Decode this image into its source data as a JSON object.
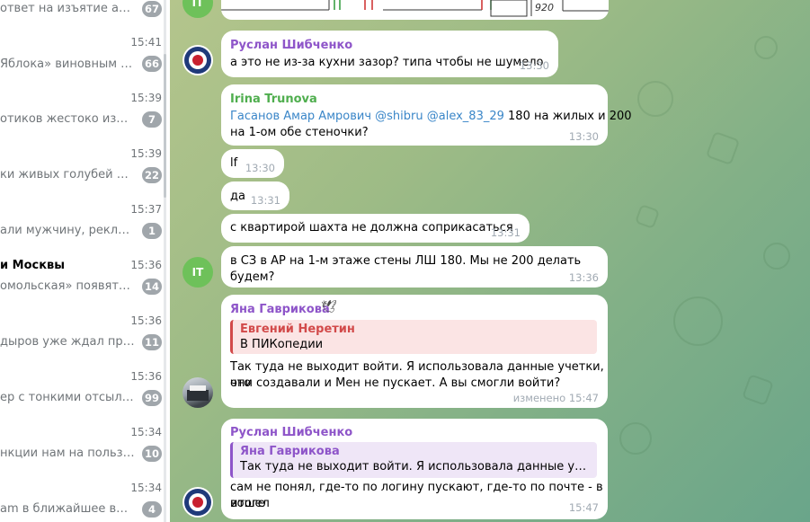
{
  "chat_list": [
    {
      "name": "",
      "time": "",
      "preview": "ответ на изъятие активо…",
      "unread": "67"
    },
    {
      "name": "",
      "time": "15:41",
      "preview": "Яблока» виновным в «…",
      "unread": "66"
    },
    {
      "name": "",
      "time": "15:39",
      "preview": "отиков жестоко избили …",
      "unread": "7"
    },
    {
      "name": "",
      "time": "15:39",
      "preview": "ки живых голубей пыт…",
      "unread": "22"
    },
    {
      "name": "",
      "time": "15:37",
      "preview": "али мужчину, реклами…",
      "unread": "1"
    },
    {
      "name": "и Москвы",
      "time": "15:36",
      "preview": "омольская» появятся н…",
      "unread": "14"
    },
    {
      "name": "",
      "time": "15:36",
      "preview": "дыров  уже ждал прик…",
      "unread": "11"
    },
    {
      "name": "",
      "time": "15:36",
      "preview": "ер с тонкими отсылка…",
      "unread": "99"
    },
    {
      "name": "",
      "time": "15:34",
      "preview": "нкции нам на пользу, а…",
      "unread": "10"
    },
    {
      "name": "",
      "time": "15:34",
      "preview": "am в ближайшее врем…",
      "unread": "4"
    }
  ],
  "image_strip": {
    "dimension": "920"
  },
  "avatar_initials": "IT",
  "messages": {
    "m1": {
      "sender": "Руслан Шибченко",
      "text": "а это не из-за кухни зазор? типа чтобы не шумело",
      "time": "13:30"
    },
    "m2": {
      "sender": "Irina Trunova",
      "mention1": "Гасанов Амар Амрович",
      "mention2": "@shibru",
      "mention3": "@alex_83_29",
      "text_after": "180 на жилых и 200",
      "text_line2": "на 1-ом обе стеночки?",
      "time": "13:30"
    },
    "m3": {
      "text": "lf",
      "time": "13:30"
    },
    "m4": {
      "text": "да",
      "time": "13:31"
    },
    "m5": {
      "text": "с квартирой шахта не должна соприкасаться",
      "time": "13:31"
    },
    "m6": {
      "text": "в СЗ в АР на 1-м этаже стены ЛШ 180. Мы не 200 делать будем?",
      "time": "13:36"
    },
    "m7": {
      "sender": "Яна Гаврикова",
      "sender_emoji": "🕊",
      "reply_name": "Евгений Неретин",
      "reply_text": "В ПИКопедии",
      "text_line1": "Так туда не выходит войти. Я использовала данные учетки, что",
      "text_line2": "они создавали и Мен не пускает. А вы смогли войти?",
      "time": "изменено 15:47"
    },
    "m8": {
      "sender": "Руслан Шибченко",
      "reply_name": "Яна Гаврикова",
      "reply_text": "Так туда не выходит войти. Я использовала данные учетки, ч…",
      "text_line1": "сам не понял, где-то по логину пускают, где-то по почте - в итоге",
      "text_line2": "вошел",
      "time": "15:47"
    }
  },
  "colors": {
    "sender_violet": "#8e55c9",
    "sender_green": "#4fae4e",
    "reply_red": "#d24a4a",
    "link_blue": "#3a86c8",
    "unread_badge": "#a0a6ab"
  }
}
